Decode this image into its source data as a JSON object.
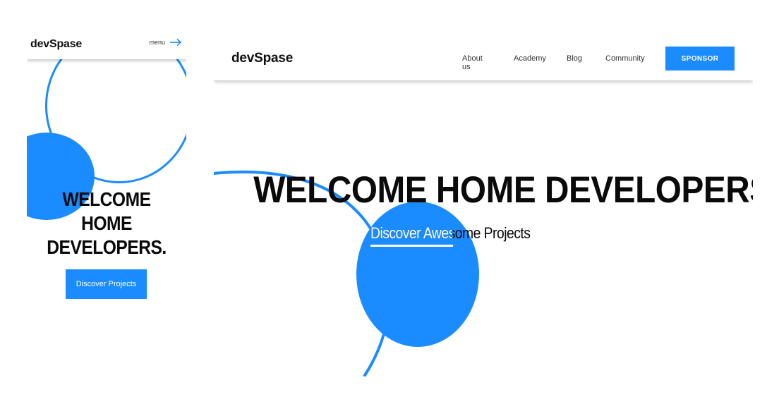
{
  "mobile": {
    "logo": "devSpase",
    "menu_label": "menu",
    "menu_icon": "arrow-right-icon",
    "hero_title_line1": "WELCOME HOME",
    "hero_title_line2": "DEVELOPERS.",
    "cta_label": "Discover Projects"
  },
  "desktop": {
    "logo": "devSpase",
    "nav": [
      "About us",
      "Academy",
      "Blog",
      "Community"
    ],
    "sponsor_label": "SPONSOR",
    "hero_title": "WELCOME HOME DEVELOPERS.",
    "subtitle": "Discover Awesome Projects"
  },
  "colors": {
    "accent": "#1a8cff",
    "text": "#0a0a0a",
    "background": "#ffffff"
  }
}
